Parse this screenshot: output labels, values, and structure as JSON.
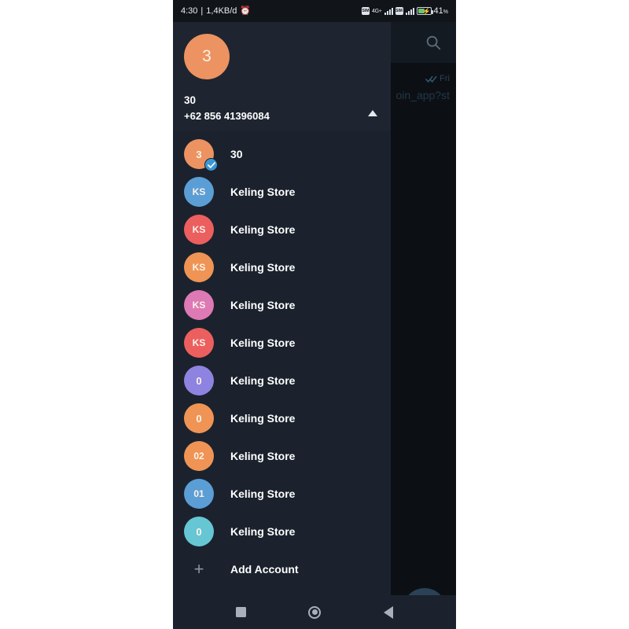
{
  "status_bar": {
    "time": "4:30",
    "separator": "|",
    "data_rate": "1,4KB/d",
    "alarm_icon": "alarm-clock-icon",
    "network_label": "4G+",
    "battery_percent": "41",
    "battery_percent_symbol": "%"
  },
  "background_screen": {
    "search_icon": "search-icon",
    "chat_day": "Fri",
    "read_receipt_icon": "double-check-icon",
    "chat_snippet": "oin_app?st",
    "fab_icon": "pencil-icon"
  },
  "drawer": {
    "header": {
      "avatar_initial": "3",
      "avatar_color": "#ec9361",
      "name": "30",
      "phone": "+62 856 41396084",
      "collapse_icon": "chevron-up-icon"
    },
    "accounts": [
      {
        "initial": "3",
        "color": "#ec9361",
        "label": "30",
        "selected": true
      },
      {
        "initial": "KS",
        "color": "#5b9ed6",
        "label": "Keling Store",
        "selected": false
      },
      {
        "initial": "KS",
        "color": "#ec5f5f",
        "label": "Keling Store",
        "selected": false
      },
      {
        "initial": "KS",
        "color": "#ef9455",
        "label": "Keling Store",
        "selected": false
      },
      {
        "initial": "KS",
        "color": "#dd79b4",
        "label": "Keling Store",
        "selected": false
      },
      {
        "initial": "KS",
        "color": "#ec5f5f",
        "label": "Keling Store",
        "selected": false
      },
      {
        "initial": "0",
        "color": "#8e83e0",
        "label": "Keling Store",
        "selected": false
      },
      {
        "initial": "0",
        "color": "#ef9455",
        "label": "Keling Store",
        "selected": false
      },
      {
        "initial": "02",
        "color": "#ef9455",
        "label": "Keling Store",
        "selected": false
      },
      {
        "initial": "01",
        "color": "#5b9ed6",
        "label": "Keling Store",
        "selected": false
      },
      {
        "initial": "0",
        "color": "#66c6d4",
        "label": "Keling Store",
        "selected": false
      }
    ],
    "add_account": {
      "label": "Add Account",
      "icon": "plus-icon"
    },
    "selected_badge_icon": "check-icon"
  },
  "nav_bar": {
    "recents_icon": "square-recents-icon",
    "home_icon": "circle-home-icon",
    "back_icon": "triangle-back-icon"
  }
}
